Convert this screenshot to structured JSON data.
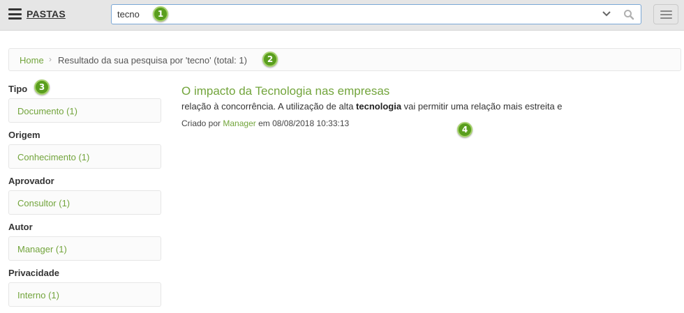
{
  "header": {
    "brand": "PASTAS",
    "search_value": "tecno",
    "icons": [
      "menu-icon",
      "chevron-down-icon",
      "search-icon",
      "hamburger-icon"
    ]
  },
  "breadcrumb": {
    "home": "Home",
    "separator": "›",
    "text": "Resultado da sua pesquisa por 'tecno' (total: 1)"
  },
  "facets": [
    {
      "title": "Tipo",
      "item": "Documento (1)"
    },
    {
      "title": "Origem",
      "item": "Conhecimento (1)"
    },
    {
      "title": "Aprovador",
      "item": "Consultor (1)"
    },
    {
      "title": "Autor",
      "item": "Manager (1)"
    },
    {
      "title": "Privacidade",
      "item": "Interno (1)"
    }
  ],
  "result": {
    "title": "O impacto da Tecnologia nas empresas",
    "snippet_before": "relação à concorrência. A utilização de alta ",
    "snippet_highlight": "tecnologia",
    "snippet_after": " vai permitir uma relação mais estreita e",
    "meta_prefix": "Criado por ",
    "author": "Manager",
    "meta_suffix": " em 08/08/2018 10:33:13"
  },
  "markers": [
    "1",
    "2",
    "3",
    "4"
  ],
  "colors": {
    "accent_green": "#72a43b",
    "marker_green": "#5a9e1e",
    "topbar_bg": "#e6e6e6",
    "search_border": "#7aa7d6"
  }
}
